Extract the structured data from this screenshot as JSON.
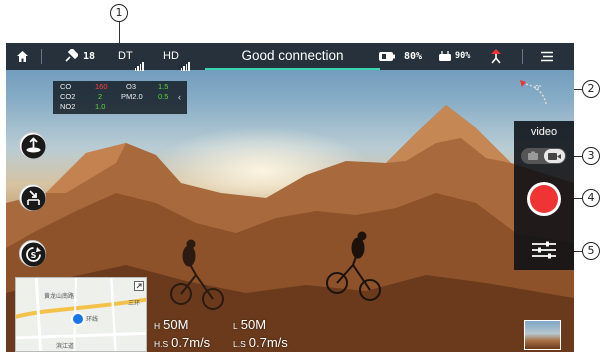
{
  "callouts": [
    "1",
    "2",
    "3",
    "4",
    "5"
  ],
  "topbar": {
    "gps_count": "18",
    "dt_label": "DT",
    "hd_label": "HD",
    "connection_status": "Good connection",
    "battery_percent": "80%",
    "rc_battery_percent": "90%",
    "accent_color": "#39d6b0"
  },
  "air_quality": {
    "rows": [
      {
        "k1": "CO",
        "v1": "160",
        "k2": "O3",
        "v2": "1.5"
      },
      {
        "k1": "CO2",
        "v1": "2",
        "k2": "PM2.0",
        "v2": "0.5"
      },
      {
        "k1": "NO2",
        "v1": "1.0",
        "k2": "",
        "v2": ""
      }
    ],
    "arrow": "‹"
  },
  "compass": {
    "heading": "0°"
  },
  "camera": {
    "mode_label": "video",
    "record_color": "#ef3433"
  },
  "map": {
    "labels": [
      "黄龙山南路",
      "三环",
      "环线",
      "滨江道"
    ]
  },
  "telemetry": {
    "h_label": "H",
    "h_value": "50M",
    "l_label": "L",
    "l_value": "50M",
    "hs_label": "H.S",
    "hs_value": "0.7m/s",
    "ls_label": "L.S",
    "ls_value": "0.7m/s"
  },
  "icons": [
    "home-icon",
    "satellite-icon",
    "signal-icon",
    "battery-icon",
    "controller-icon",
    "rth-icon",
    "menu-icon",
    "takeoff-icon",
    "landing-icon",
    "return-icon",
    "camera-icon",
    "video-icon",
    "settings-icon",
    "location-icon",
    "expand-icon"
  ]
}
